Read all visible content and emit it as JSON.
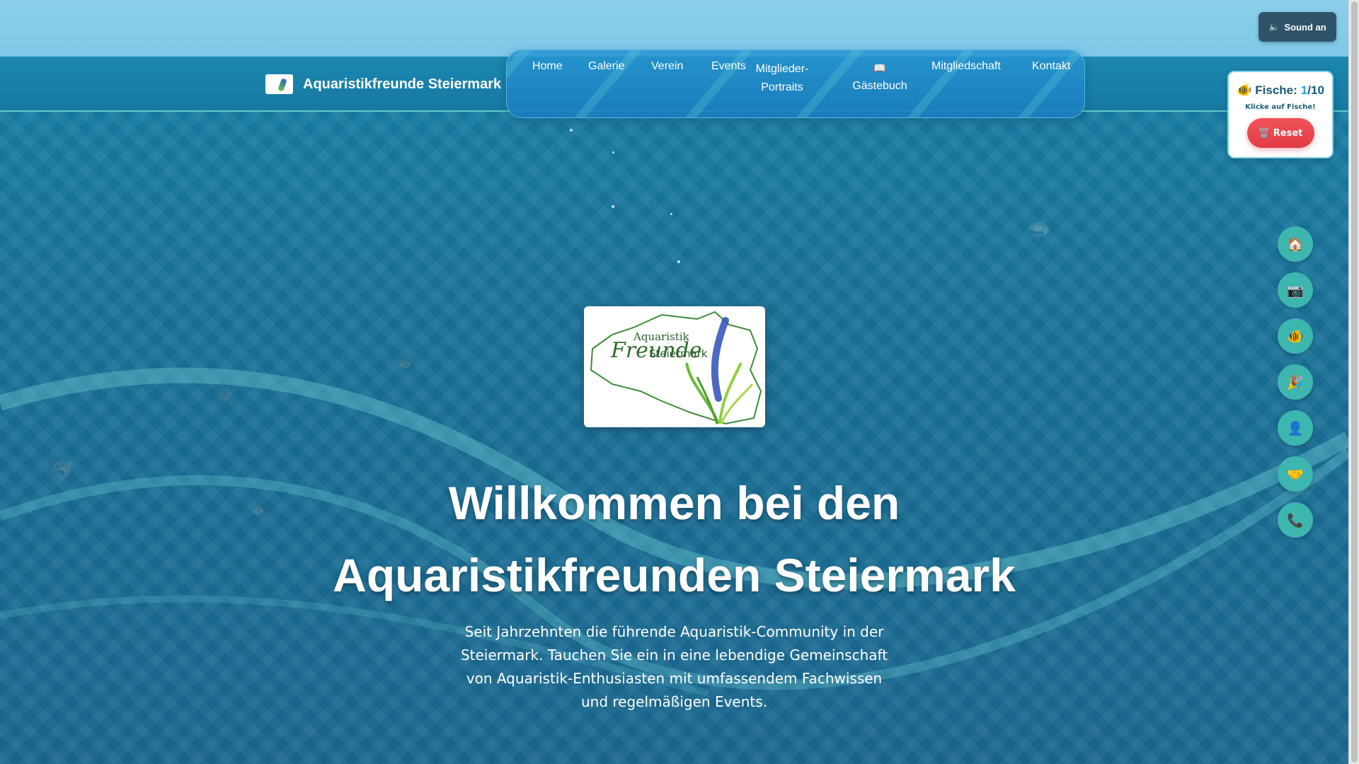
{
  "sound_button": {
    "icon": "speaker-muted-icon",
    "label": "Sound an"
  },
  "brand": {
    "name": "Aquaristikfreunde Steiermark"
  },
  "nav": {
    "items": [
      {
        "label": "Home"
      },
      {
        "label": "Galerie"
      },
      {
        "label": "Verein"
      },
      {
        "label": "Events"
      },
      {
        "label": "Mitglieder-Portraits",
        "line1": "Mitglieder-",
        "line2": "Portraits"
      },
      {
        "label": "Gästebuch",
        "icon": "book-icon"
      },
      {
        "label": "Mitgliedschaft"
      },
      {
        "label": "Kontakt"
      }
    ]
  },
  "fish_game": {
    "label": "Fische:",
    "count": "1",
    "total": "/10",
    "hint": "Klicke auf Fische!",
    "reset_label": "Reset",
    "reset_icon": "trash-icon"
  },
  "side_nav": [
    {
      "icon": "house-icon",
      "glyph": "🏠"
    },
    {
      "icon": "camera-icon",
      "glyph": "📷"
    },
    {
      "icon": "fish-icon",
      "glyph": "🐠"
    },
    {
      "icon": "party-popper-icon",
      "glyph": "🎉"
    },
    {
      "icon": "person-icon",
      "glyph": "👤"
    },
    {
      "icon": "handshake-icon",
      "glyph": "🤝"
    },
    {
      "icon": "phone-icon",
      "glyph": "📞"
    }
  ],
  "hero": {
    "logo_text": {
      "line1": "Aquaristik",
      "line2": "Freunde",
      "line3": "Steiermark"
    },
    "title_line1": "Willkommen bei den",
    "title_line2": "Aquaristikfreunden Steiermark",
    "description": "Seit Jahrzehnten die führende Aquaristik-Community in der Steiermark. Tauchen Sie ein in eine lebendige Gemeinschaft von Aquaristik-Enthusiasten mit umfassendem Fachwissen und regelmäßigen Events."
  },
  "colors": {
    "ocean": "#1a7198",
    "header": "#1c87b0",
    "accent_teal": "#3db6b0",
    "reset_red": "#e23c45"
  }
}
